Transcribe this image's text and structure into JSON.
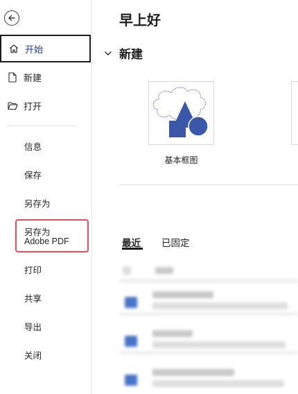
{
  "sidebar": {
    "nav": [
      {
        "label": "开始",
        "icon": "home-icon",
        "active": true
      },
      {
        "label": "新建",
        "icon": "new-file-icon",
        "active": false
      },
      {
        "label": "打开",
        "icon": "folder-open-icon",
        "active": false
      }
    ],
    "items": [
      {
        "label": "信息"
      },
      {
        "label": "保存"
      },
      {
        "label": "另存为"
      },
      {
        "label_line1": "另存为",
        "label_line2": "Adobe PDF"
      },
      {
        "label": "打印"
      },
      {
        "label": "共享"
      },
      {
        "label": "导出"
      },
      {
        "label": "关闭"
      }
    ]
  },
  "main": {
    "greeting": "早上好",
    "new_section": {
      "title": "新建",
      "templates": [
        {
          "label": "基本框图"
        }
      ]
    },
    "tabs": [
      {
        "label": "最近",
        "active": true
      },
      {
        "label": "已固定",
        "active": false
      }
    ]
  },
  "colors": {
    "accent": "#1a3c8a",
    "highlight_border": "#e34a5a",
    "shape_blue": "#3b57a8"
  }
}
